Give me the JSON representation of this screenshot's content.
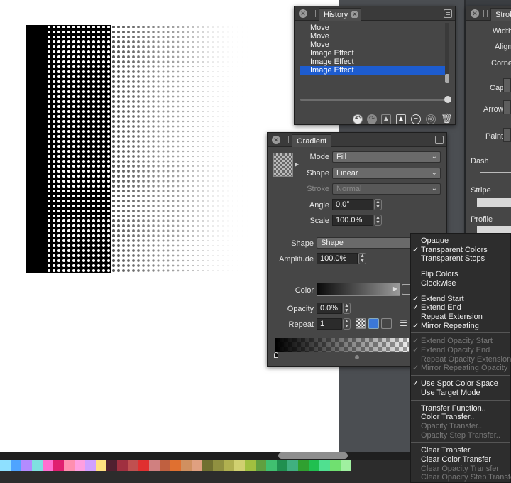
{
  "history_panel": {
    "tab_label": "History",
    "items": [
      "Move",
      "Move",
      "Move",
      "Image Effect",
      "Image Effect",
      "Image Effect"
    ],
    "selected_index": 5
  },
  "stroke_panel": {
    "tab_label": "Stroke",
    "labels": {
      "width": "Width",
      "align": "Align",
      "corner": "Corner",
      "cap": "Cap",
      "arrow": "Arrow",
      "paint": "Paint",
      "dash": "Dash",
      "stripe": "Stripe",
      "profile": "Profile"
    }
  },
  "gradient_panel": {
    "tab_label": "Gradient",
    "mode_label": "Mode",
    "mode_value": "Fill",
    "shape_label": "Shape",
    "shape_value": "Linear",
    "stroke_label": "Stroke",
    "stroke_value": "Normal",
    "angle_label": "Angle",
    "angle_value": "0.0°",
    "scale_label": "Scale",
    "scale_value": "100.0%",
    "shape2_label": "Shape",
    "shape2_value": "Shape",
    "amplitude_label": "Amplitude",
    "amplitude_value": "100.0%",
    "color_label": "Color",
    "opacity_label": "Opacity",
    "opacity_value": "0.0%",
    "repeat_label": "Repeat",
    "repeat_value": "1"
  },
  "context_menu": {
    "groups": [
      [
        {
          "label": "Opaque",
          "checked": false,
          "disabled": false
        },
        {
          "label": "Transparent Colors",
          "checked": true,
          "disabled": false
        },
        {
          "label": "Transparent Stops",
          "checked": false,
          "disabled": false
        }
      ],
      [
        {
          "label": "Flip Colors",
          "checked": false,
          "disabled": false
        },
        {
          "label": "Clockwise",
          "checked": false,
          "disabled": false
        }
      ],
      [
        {
          "label": "Extend Start",
          "checked": true,
          "disabled": false
        },
        {
          "label": "Extend End",
          "checked": true,
          "disabled": false
        },
        {
          "label": "Repeat Extension",
          "checked": false,
          "disabled": false
        },
        {
          "label": "Mirror Repeating",
          "checked": true,
          "disabled": false
        }
      ],
      [
        {
          "label": "Extend Opacity Start",
          "checked": true,
          "disabled": true
        },
        {
          "label": "Extend Opacity End",
          "checked": true,
          "disabled": true
        },
        {
          "label": "Repeat Opacity Extension",
          "checked": false,
          "disabled": true
        },
        {
          "label": "Mirror Repeating Opacity",
          "checked": true,
          "disabled": true
        }
      ],
      [
        {
          "label": "Use Spot Color Space",
          "checked": true,
          "disabled": false
        },
        {
          "label": "Use Target Mode",
          "checked": false,
          "disabled": false
        }
      ],
      [
        {
          "label": "Transfer Function..",
          "checked": false,
          "disabled": false
        },
        {
          "label": "Color Transfer..",
          "checked": false,
          "disabled": false
        },
        {
          "label": "Opacity Transfer..",
          "checked": false,
          "disabled": true
        },
        {
          "label": "Opacity Step Transfer..",
          "checked": false,
          "disabled": true
        }
      ],
      [
        {
          "label": "Clear Transfer",
          "checked": false,
          "disabled": false
        },
        {
          "label": "Clear Color Transfer",
          "checked": false,
          "disabled": false
        },
        {
          "label": "Clear Opacity Transfer",
          "checked": false,
          "disabled": true
        },
        {
          "label": "Clear Opacity Step Transfer",
          "checked": false,
          "disabled": true
        }
      ]
    ]
  },
  "palette_colors": [
    "#8ee0ff",
    "#4fa4ff",
    "#b38bff",
    "#7fe0e0",
    "#ff6fd0",
    "#e02070",
    "#ff8fb0",
    "#ff9fe0",
    "#d0a0ff",
    "#ffe080",
    "#502030",
    "#a03040",
    "#c05050",
    "#e03030",
    "#d08080",
    "#c06040",
    "#e07030",
    "#d09060",
    "#e0a080",
    "#707030",
    "#909040",
    "#b0b050",
    "#d0d070",
    "#a0c040",
    "#60a040",
    "#40c070",
    "#209050",
    "#40b080",
    "#30a030",
    "#20c050",
    "#50e090",
    "#70e070",
    "#a0f0a0"
  ],
  "colors": {
    "selection": "#1d5ccf",
    "panel": "#464646",
    "canvas": "#ffffff"
  }
}
